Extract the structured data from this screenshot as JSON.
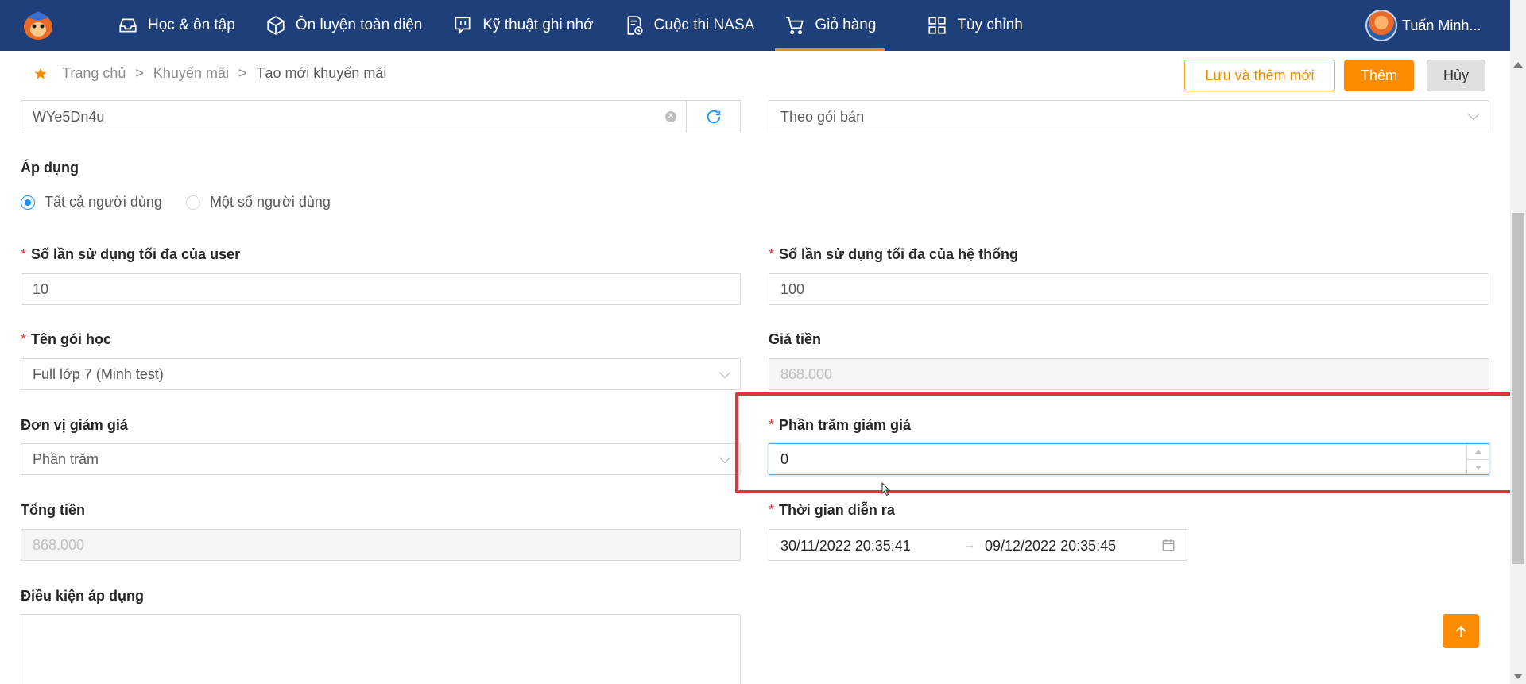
{
  "nav": {
    "items": [
      {
        "label": "Học & ôn tập",
        "icon": "inbox-icon"
      },
      {
        "label": "Ôn luyện toàn diện",
        "icon": "cube-icon"
      },
      {
        "label": "Kỹ thuật ghi nhớ",
        "icon": "chat-icon"
      },
      {
        "label": "Cuộc thi NASA",
        "icon": "document-clock-icon"
      },
      {
        "label": "Giỏ hàng",
        "icon": "cart-icon",
        "active": true
      },
      {
        "label": "Tùy chỉnh",
        "icon": "grid-icon"
      }
    ],
    "user_name": "Tuấn Minh..."
  },
  "breadcrumb": {
    "home": "Trang chủ",
    "section": "Khuyến mãi",
    "current": "Tạo mới khuyến mãi",
    "separator": ">"
  },
  "actions": {
    "save_and_add": "Lưu và thêm mới",
    "add": "Thêm",
    "cancel": "Hủy"
  },
  "form": {
    "code_value": "WYe5Dn4u",
    "type_value": "Theo gói bán",
    "apply_label": "Áp dụng",
    "apply_options": [
      "Tất cả người dùng",
      "Một số người dùng"
    ],
    "apply_selected": "Tất cả người dùng",
    "max_user_label": "Số lần sử dụng tối đa của user",
    "max_user_value": "10",
    "max_system_label": "Số lần sử dụng tối đa của hệ thống",
    "max_system_value": "100",
    "package_label": "Tên gói học",
    "package_value": "Full lớp 7 (Minh test)",
    "price_label": "Giá tiền",
    "price_value": "868.000",
    "discount_unit_label": "Đơn vị giảm giá",
    "discount_unit_value": "Phần trăm",
    "discount_percent_label": "Phần trăm giảm giá",
    "discount_percent_value": "0",
    "total_label": "Tổng tiền",
    "total_value": "868.000",
    "time_label": "Thời gian diễn ra",
    "time_start": "30/11/2022 20:35:41",
    "time_end": "09/12/2022 20:35:45",
    "time_separator": "→",
    "condition_label": "Điều kiện áp dụng"
  },
  "colors": {
    "nav_bg": "#1e3f7a",
    "accent": "#ff8c00",
    "highlight": "#d9363e",
    "required": "#e0353a"
  }
}
